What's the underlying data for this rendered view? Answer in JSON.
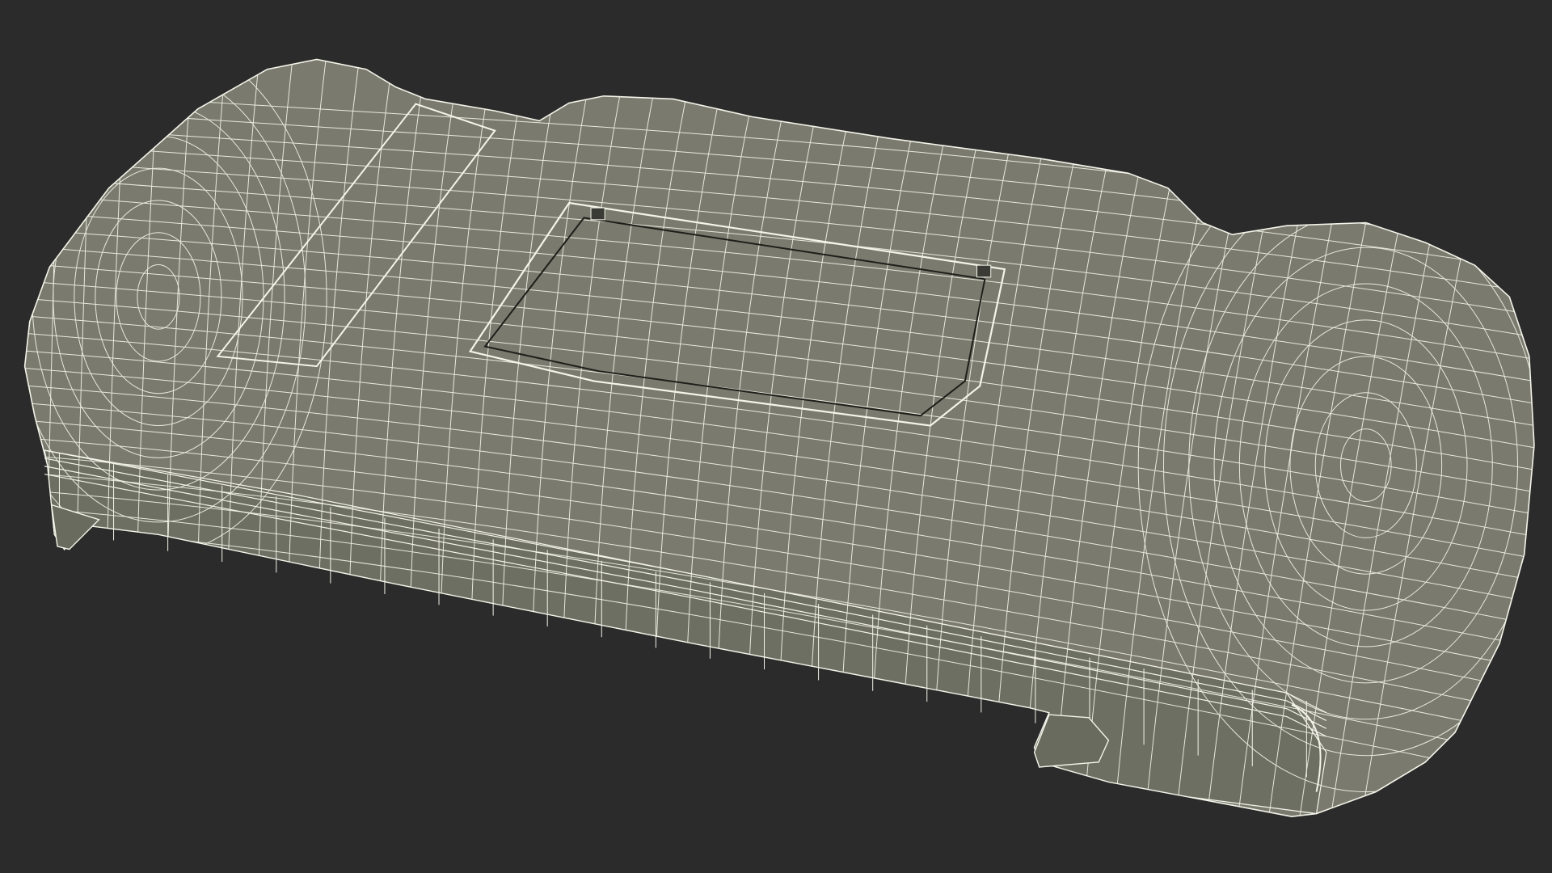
{
  "scene": {
    "background_color": "#2b2b2b",
    "model_fill_color": "#7a7b6e",
    "model_shade_color": "#6e6f63",
    "wire_color": "#f4f4ea",
    "render_mode": "wireframe-on-shaded",
    "subject": "handheld-console-grip-case"
  }
}
